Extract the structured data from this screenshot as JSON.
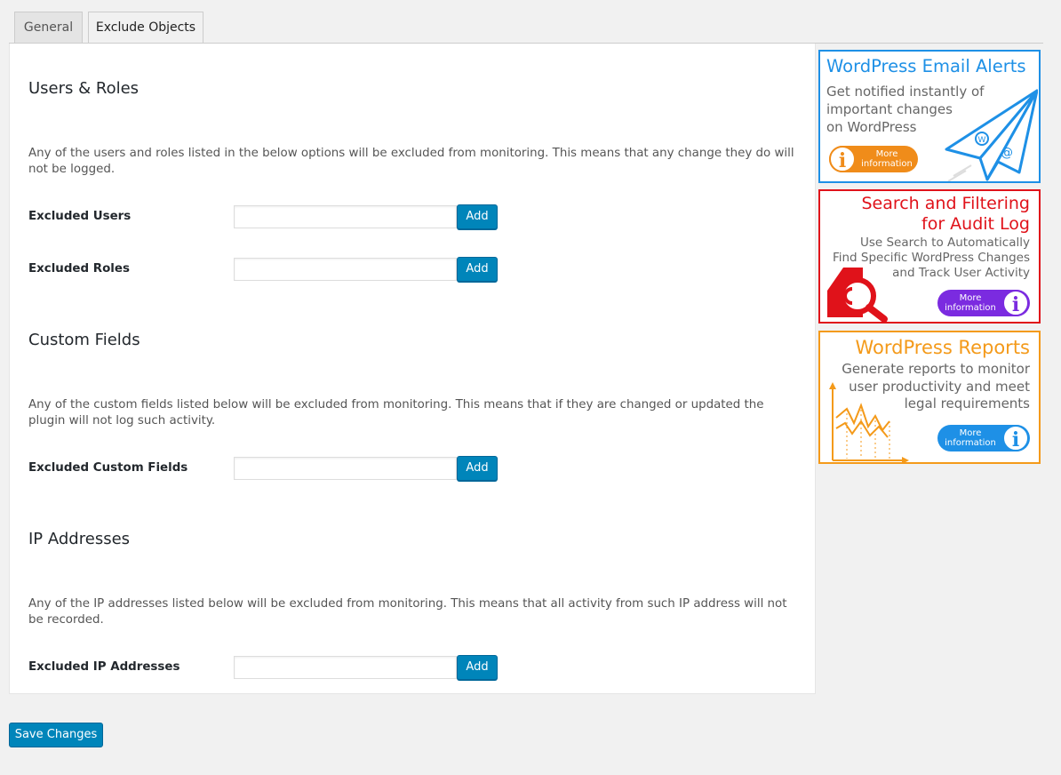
{
  "tabs": [
    {
      "label": "General"
    },
    {
      "label": "Exclude Objects"
    }
  ],
  "sections": {
    "users": {
      "heading": "Users & Roles",
      "description": "Any of the users and roles listed in the below options will be excluded from monitoring. This means that any change they do will not be logged.",
      "excluded_users_label": "Excluded Users",
      "excluded_users_value": "",
      "excluded_roles_label": "Excluded Roles",
      "excluded_roles_value": ""
    },
    "custom_fields": {
      "heading": "Custom Fields",
      "description": "Any of the custom fields listed below will be excluded from monitoring. This means that if they are changed or updated the plugin will not log such activity.",
      "excluded_fields_label": "Excluded Custom Fields",
      "excluded_fields_value": ""
    },
    "ip": {
      "heading": "IP Addresses",
      "description": "Any of the IP addresses listed below will be excluded from monitoring. This means that all activity from such IP address will not be recorded.",
      "excluded_ips_label": "Excluded IP Addresses",
      "excluded_ips_value": ""
    }
  },
  "add_label": "Add",
  "save_label": "Save Changes",
  "ads": {
    "email": {
      "title": "WordPress Email Alerts",
      "subtitle": "Get notified instantly of\nimportant changes\non WordPress",
      "more": "More\ninformation",
      "color": "#1e90e6"
    },
    "search": {
      "title_line1": "Search and Filtering",
      "title_line2": "for Audit Log",
      "subtitle": "Use Search to Automatically\nFind Specific WordPress Changes\nand Track User Activity",
      "more": "More\ninformation",
      "color": "#e0121a"
    },
    "reports": {
      "title": "WordPress Reports",
      "subtitle": "Generate reports to monitor\nuser productivity and meet\nlegal requirements",
      "more": "More\ninformation",
      "color": "#f49a1a"
    }
  }
}
